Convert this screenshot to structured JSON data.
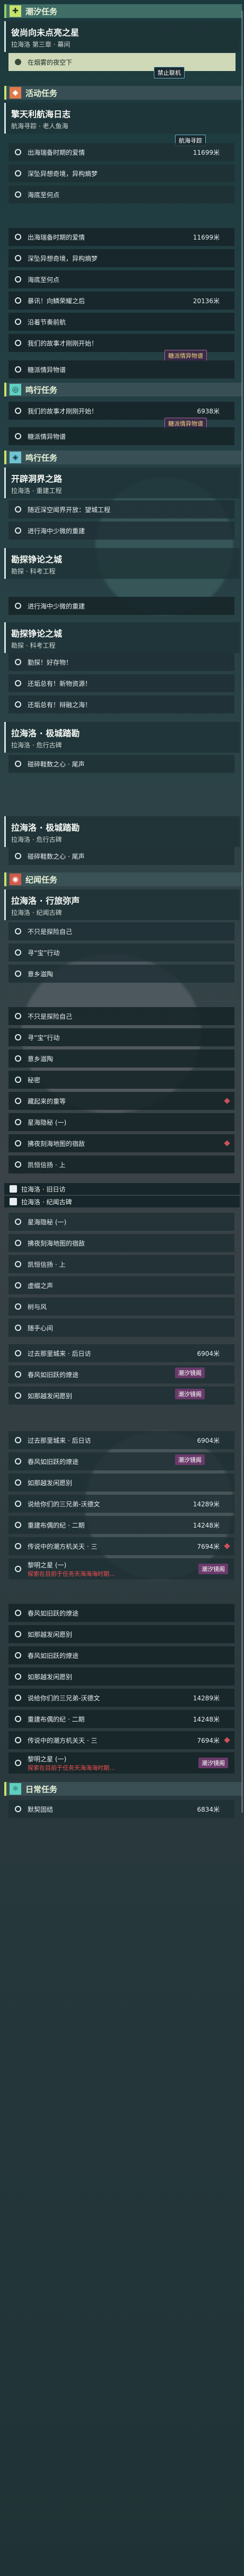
{
  "sections": {
    "tide": "潮汐任务",
    "event": "活动任务",
    "cycle": "鸣行任务",
    "side": "鸣行任务",
    "legend": "纪闻任务",
    "daily": "日常任务"
  },
  "tide_quest": {
    "title": "彼尚向未点亮之星",
    "sub": "拉海洛 第三章 · 幕间",
    "step": "在烟雾的夜空下"
  },
  "event_quest": {
    "title": "擎天利航海日志",
    "sub": "航海寻踪 · 老人鱼海",
    "steps": [
      "出海瑞备时期的爱情",
      "深坠异想奇境，异构熵梦",
      "海底至何点"
    ],
    "d1": "11699米",
    "badge_block": "禁止联机",
    "badge_block2": "航海寻踪",
    "steps2": [
      "出海瑞备时期的爱情",
      "深坠异想奇境，异构熵梦",
      "海底至何点",
      "暴讯！向鳞荣耀之后",
      "沿着节奏前航",
      "我们的故事才刚刚开始！",
      "糖派情异物谱"
    ],
    "d2": "11699米",
    "d3": "20136米",
    "badge_exp": "糖派情异物谱"
  },
  "cycle_quest": {
    "steps": [
      "我们的故事才刚刚开始！",
      "糖派情异物谱"
    ],
    "d": "6938米",
    "badge_exp": "糖派情异物谱"
  },
  "side_quest": {
    "q1": {
      "title": "开辟洞界之路",
      "sub": "拉海洛 · 重建工程",
      "steps": [
        "随近深空闻界开放：望城工程",
        "进行海中少微的重建"
      ]
    },
    "q2": {
      "title": "勘探铮论之城",
      "sub": "勘探 · 科考工程",
      "steps": [
        "进行海中少微的重建"
      ]
    },
    "q3": {
      "title": "勘探铮论之城",
      "sub": "勘探 · 科考工程",
      "steps": [
        "勤探！好存物！",
        "还垢总有！新物资源！",
        "还垢总有！辩融之海！"
      ]
    },
    "q4": {
      "title": "拉海洛 · 极城踏勘",
      "sub": "拉海洛 · 危行古碑",
      "steps": [
        "碰碎鞋数之心 · 尾声"
      ]
    },
    "q5": {
      "title": "拉海洛 · 极城踏勘",
      "sub": "拉海洛 · 危行古碑",
      "steps": [
        "碰碎鞋数之心 · 尾声"
      ]
    }
  },
  "legend_quest": {
    "title": "拉海洛 · 行旅弥声",
    "sub": "拉海洛 · 纪闻古碑",
    "steps": [
      "不只是探险自己",
      "寻“宝”行动",
      "意乡滋陶",
      "不只是探险自己",
      "寻“宝”行动",
      "意乡滋陶",
      "秘密",
      "藏起来的重等",
      "星海隐秘 (一)",
      "拂夜刻海地图的宿敌",
      "凯恒信扬 · 上",
      "星海隐秘 (一)",
      "拂夜刻海地图的宿敌",
      "凯恒信扬 · 上",
      "虚缀之声",
      "树与风",
      "随手心间"
    ],
    "chapter1": "拉海洛 · 旧日访",
    "chapter2": "拉海洛 · 纪闻古碑",
    "more_steps": [
      "过去那里城来 · 后日访",
      "春风如旧跃的燎途",
      "如那越发闲愿别",
      "说给你们的三兄弟-沃德文",
      "重建布偶的纪 · 二期",
      "传说中的潮方机关天 · 三",
      "黎明之星 (一)"
    ],
    "d_a": "6904米",
    "d_b": "14289米",
    "d_c": "14248米",
    "d_d": "7694米",
    "badge_p": "潮汐镜阁",
    "more_steps2": [
      "过去那里城来 · 后日访",
      "春风如旧跃的燎途",
      "如那越发闲愿别",
      "说给你们的三兄弟-沃德文",
      "重建布偶的纪 · 二期",
      "传说中的潮方机关天 · 三",
      "黎明之星 (一)"
    ],
    "red": "探索在目前于任务天海海海时期..."
  },
  "daily": {
    "step": "默契固结",
    "d": "6834米"
  }
}
